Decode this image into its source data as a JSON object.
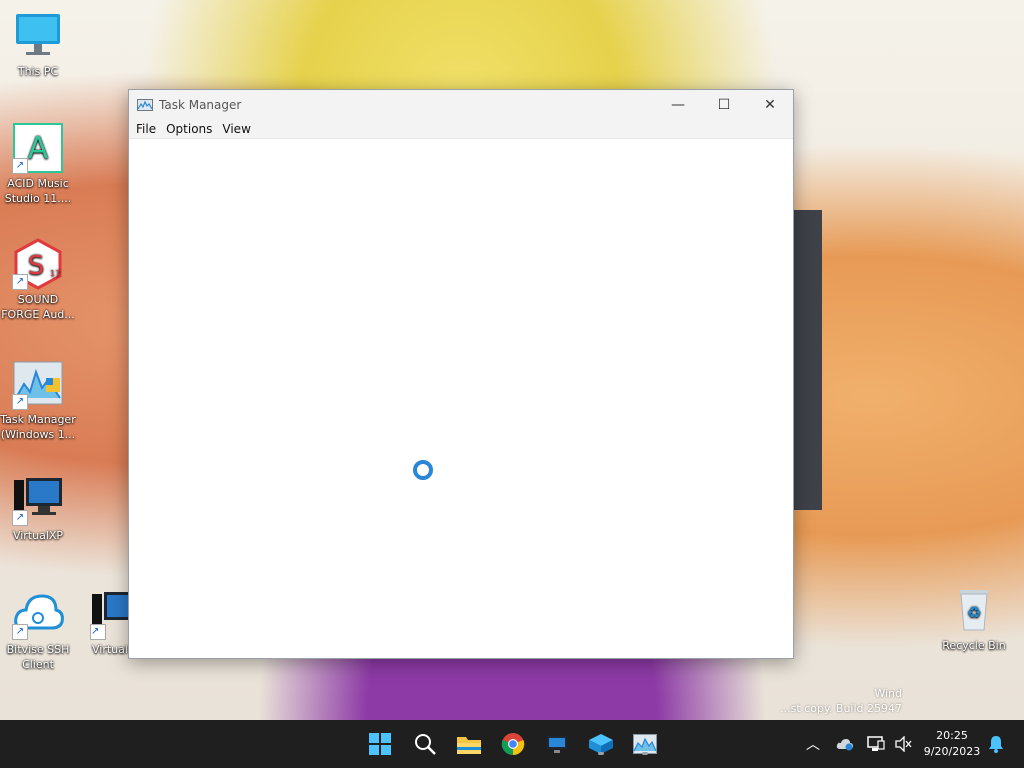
{
  "desktop": {
    "icons": [
      {
        "label": "This PC"
      },
      {
        "label": "ACID Music Studio 11...."
      },
      {
        "label": "SOUND FORGE Aud..."
      },
      {
        "label": "Task Manager (Windows 1..."
      },
      {
        "label": "VirtualXP"
      },
      {
        "label": "Bitvise SSH Client"
      },
      {
        "label": "Virtual"
      },
      {
        "label": "Recycle Bin"
      }
    ],
    "watermark_line1": "Wind",
    "watermark_line2": "...st copy. Build 25947"
  },
  "window": {
    "title": "Task Manager",
    "menu": [
      "File",
      "Options",
      "View"
    ],
    "minimize_glyph": "—",
    "maximize_glyph": "☐",
    "close_glyph": "✕"
  },
  "taskbar": {
    "time": "20:25",
    "date": "9/20/2023",
    "chevron_glyph": "︿"
  },
  "colors": {
    "accent": "#2a86d6",
    "taskbar_bg": "#1f1f1f"
  }
}
